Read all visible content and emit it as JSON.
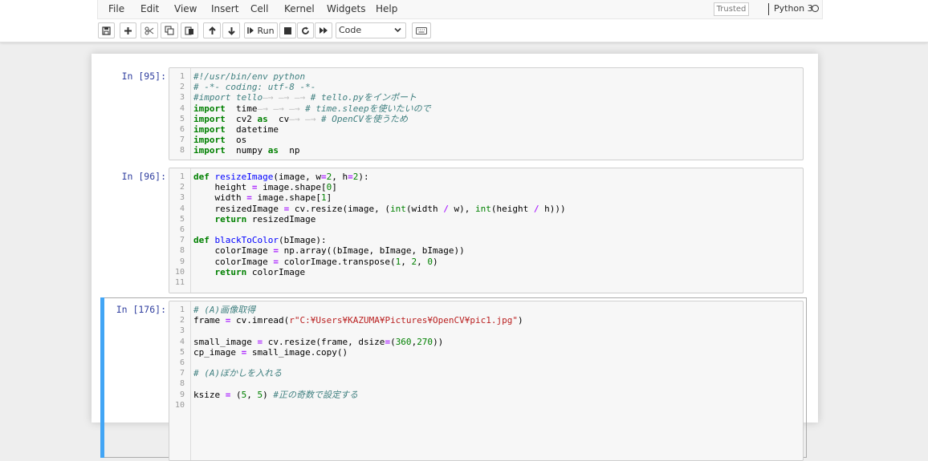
{
  "menu": [
    "File",
    "Edit",
    "View",
    "Insert",
    "Cell",
    "Kernel",
    "Widgets",
    "Help"
  ],
  "status": {
    "trusted": "Trusted",
    "kernel": "Python 3"
  },
  "toolbar": {
    "buttons": [
      "save-icon",
      "plus-icon",
      "scissors-icon",
      "copy-icon",
      "paste-icon",
      "arrow-up-icon",
      "arrow-down-icon",
      "run",
      "stop-icon",
      "restart-icon",
      "fast-forward-icon",
      "keyboard-icon"
    ],
    "run_label": "Run",
    "cell_type": "Code"
  },
  "cells": [
    {
      "prompt": "In [95]:",
      "lines": [
        [
          [
            "cm",
            "#!/usr/bin/env python"
          ]
        ],
        [
          [
            "cm",
            "# -*- coding: utf-8 -*-"
          ]
        ],
        [
          [
            "cm",
            "#import tello\t\t\t# tello.pyをインポート"
          ]
        ],
        [
          [
            "kw",
            "import"
          ],
          [
            "",
            "  time\t\t\t"
          ],
          [
            "cm",
            "# time.sleepを使いたいので"
          ]
        ],
        [
          [
            "kw",
            "import"
          ],
          [
            "",
            "  cv2 "
          ],
          [
            "kw",
            "as"
          ],
          [
            "",
            "  cv\t\t"
          ],
          [
            "cm",
            "# OpenCVを使うため"
          ]
        ],
        [
          [
            "kw",
            "import"
          ],
          [
            "",
            "  datetime"
          ]
        ],
        [
          [
            "kw",
            "import"
          ],
          [
            "",
            "  os"
          ]
        ],
        [
          [
            "kw",
            "import"
          ],
          [
            "",
            "  numpy "
          ],
          [
            "kw",
            "as"
          ],
          [
            "",
            "  np"
          ]
        ]
      ]
    },
    {
      "prompt": "In [96]:",
      "lines": [
        [
          [
            "kw",
            "def"
          ],
          [
            "",
            " "
          ],
          [
            "fn",
            "resizeImage"
          ],
          [
            "",
            "(image, w"
          ],
          [
            "op",
            "="
          ],
          [
            "nm",
            "2"
          ],
          [
            "",
            ", h"
          ],
          [
            "op",
            "="
          ],
          [
            "nm",
            "2"
          ],
          [
            "",
            "):"
          ]
        ],
        [
          [
            "",
            "    height "
          ],
          [
            "op",
            "="
          ],
          [
            "",
            " image.shape["
          ],
          [
            "nm",
            "0"
          ],
          [
            "",
            "]"
          ]
        ],
        [
          [
            "",
            "    width "
          ],
          [
            "op",
            "="
          ],
          [
            "",
            " image.shape["
          ],
          [
            "nm",
            "1"
          ],
          [
            "",
            "]"
          ]
        ],
        [
          [
            "",
            "    resizedImage "
          ],
          [
            "op",
            "="
          ],
          [
            "",
            " cv.resize(image, ("
          ],
          [
            "bi",
            "int"
          ],
          [
            "",
            "(width "
          ],
          [
            "op",
            "/"
          ],
          [
            "",
            " w), "
          ],
          [
            "bi",
            "int"
          ],
          [
            "",
            "(height "
          ],
          [
            "op",
            "/"
          ],
          [
            "",
            " h)))"
          ]
        ],
        [
          [
            "",
            "    "
          ],
          [
            "kw",
            "return"
          ],
          [
            "",
            " resizedImage"
          ]
        ],
        [
          [
            "",
            ""
          ]
        ],
        [
          [
            "kw",
            "def"
          ],
          [
            "",
            " "
          ],
          [
            "fn",
            "blackToColor"
          ],
          [
            "",
            "(bImage):"
          ]
        ],
        [
          [
            "",
            "    colorImage "
          ],
          [
            "op",
            "="
          ],
          [
            "",
            " np.array((bImage, bImage, bImage))"
          ]
        ],
        [
          [
            "",
            "    colorImage "
          ],
          [
            "op",
            "="
          ],
          [
            "",
            " colorImage.transpose("
          ],
          [
            "nm",
            "1"
          ],
          [
            "",
            ", "
          ],
          [
            "nm",
            "2"
          ],
          [
            "",
            ", "
          ],
          [
            "nm",
            "0"
          ],
          [
            "",
            ")"
          ]
        ],
        [
          [
            "",
            "    "
          ],
          [
            "kw",
            "return"
          ],
          [
            "",
            " colorImage"
          ]
        ],
        [
          [
            "",
            ""
          ]
        ]
      ]
    },
    {
      "prompt": "In [176]:",
      "lines": [
        [
          [
            "cm",
            "# (A)画像取得"
          ]
        ],
        [
          [
            "",
            "frame "
          ],
          [
            "op",
            "="
          ],
          [
            "",
            " cv.imread("
          ],
          [
            "st",
            "r\"C:¥Users¥KAZUMA¥Pictures¥OpenCV¥pic1.jpg\""
          ],
          [
            "",
            ")"
          ]
        ],
        [
          [
            "",
            ""
          ]
        ],
        [
          [
            "",
            "small_image "
          ],
          [
            "op",
            "="
          ],
          [
            "",
            " cv.resize(frame, dsize"
          ],
          [
            "op",
            "="
          ],
          [
            "",
            "("
          ],
          [
            "nm",
            "360"
          ],
          [
            "",
            ","
          ],
          [
            "nm",
            "270"
          ],
          [
            "",
            "))"
          ]
        ],
        [
          [
            "",
            "cp_image "
          ],
          [
            "op",
            "="
          ],
          [
            "",
            " small_image.copy()"
          ]
        ],
        [
          [
            "",
            ""
          ]
        ],
        [
          [
            "cm",
            "# (A)ぼかしを入れる"
          ]
        ],
        [
          [
            "",
            ""
          ]
        ],
        [
          [
            "",
            "ksize "
          ],
          [
            "op",
            "="
          ],
          [
            "",
            " ("
          ],
          [
            "nm",
            "5"
          ],
          [
            "",
            ", "
          ],
          [
            "nm",
            "5"
          ],
          [
            "",
            ") "
          ],
          [
            "cm",
            "#正の奇数で設定する"
          ]
        ],
        [
          [
            "",
            ""
          ]
        ]
      ]
    }
  ]
}
